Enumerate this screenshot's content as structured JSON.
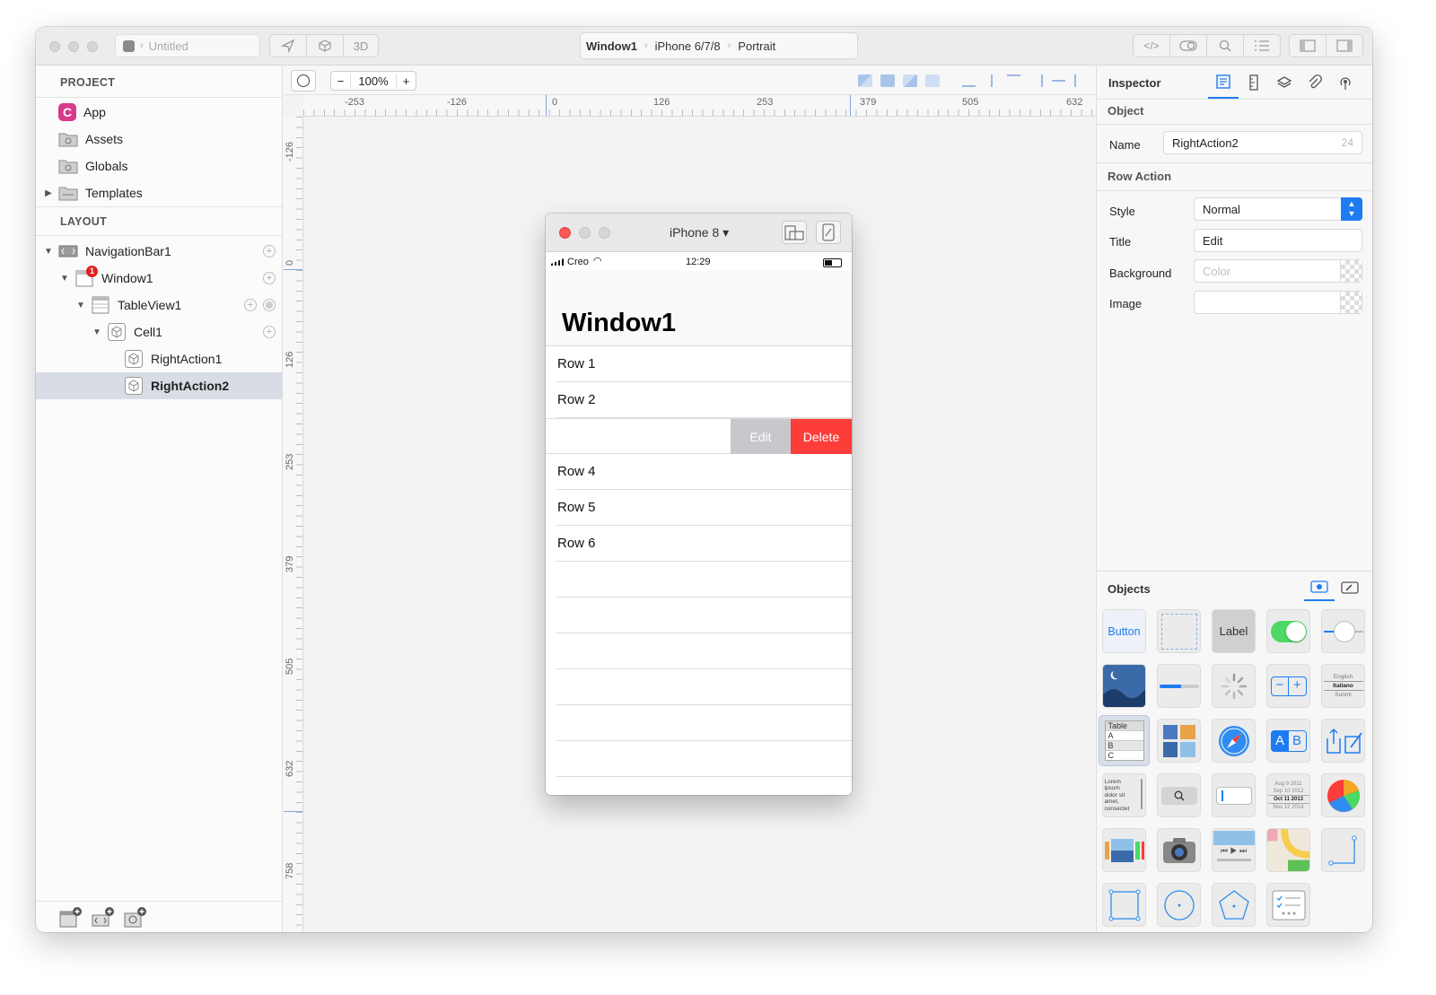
{
  "titlebar": {
    "document_name": "Untitled",
    "three_d_label": "3D",
    "breadcrumb": [
      "Window1",
      "iPhone 6/7/8",
      "Portrait"
    ]
  },
  "project": {
    "header": "PROJECT",
    "items": [
      {
        "label": "App",
        "icon": "app-icon"
      },
      {
        "label": "Assets",
        "icon": "folder-icon"
      },
      {
        "label": "Globals",
        "icon": "folder-icon"
      },
      {
        "label": "Templates",
        "icon": "folder-icon"
      }
    ]
  },
  "layout": {
    "header": "LAYOUT",
    "items": [
      {
        "label": "NavigationBar1"
      },
      {
        "label": "Window1",
        "badge": "1"
      },
      {
        "label": "TableView1"
      },
      {
        "label": "Cell1"
      },
      {
        "label": "RightAction1"
      },
      {
        "label": "RightAction2"
      }
    ]
  },
  "canvas": {
    "zoom": "100%",
    "hruler_labels": [
      "-253",
      "-126",
      "0",
      "126",
      "253",
      "379",
      "505",
      "632"
    ],
    "vruler_labels": [
      "-126",
      "0",
      "126",
      "253",
      "379",
      "505",
      "632",
      "758"
    ]
  },
  "simulator": {
    "device": "iPhone 8 ▾",
    "carrier": "Creo",
    "time": "12:29",
    "nav_title": "Window1",
    "rows": [
      "Row 1",
      "Row 2",
      "",
      "Row 4",
      "Row 5",
      "Row 6"
    ],
    "edit_action": "Edit",
    "delete_action": "Delete",
    "delete_color": "#fc3d39",
    "edit_color": "#c7c7cc"
  },
  "inspector": {
    "title": "Inspector",
    "object_header": "Object",
    "name_label": "Name",
    "name_value": "RightAction2",
    "name_count": "24",
    "row_action_header": "Row Action",
    "style_label": "Style",
    "style_value": "Normal",
    "title_label": "Title",
    "title_value": "Edit",
    "background_label": "Background",
    "background_placeholder": "Color",
    "image_label": "Image"
  },
  "objects": {
    "title": "Objects",
    "button_label": "Button",
    "label_label": "Label",
    "table_tile": [
      "Table",
      "A",
      "B",
      "C"
    ],
    "picker_tile": [
      "English",
      "Italiano",
      "Suomi"
    ],
    "text_tile": [
      "Lorem",
      "ipsum",
      "dolor sit",
      "amet,",
      "consectet"
    ],
    "date_tile": [
      "Aug 9 2011",
      "Sep 10 2012",
      "Oct 11 2013",
      "Nov 12 2014"
    ]
  },
  "accent_color": "#1e7cf2"
}
